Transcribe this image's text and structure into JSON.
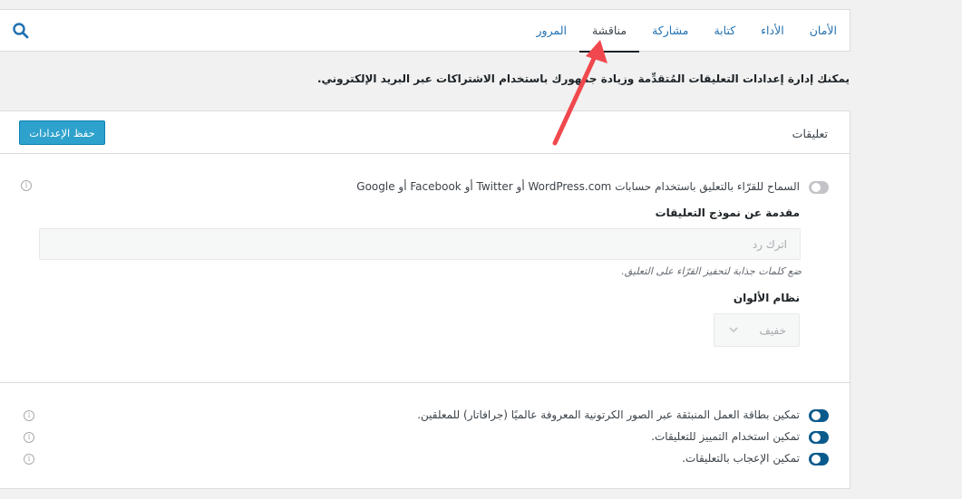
{
  "tabs": [
    {
      "label": "الأمان",
      "active": false
    },
    {
      "label": "الأداء",
      "active": false
    },
    {
      "label": "كتابة",
      "active": false
    },
    {
      "label": "مشاركة",
      "active": false
    },
    {
      "label": "مناقشة",
      "active": true
    },
    {
      "label": "المرور",
      "active": false
    }
  ],
  "intro": "يمكنك إدارة إعدادات التعليقات المُتقدِّمة وزيادة جمهورك باستخدام الاشتراكات عبر البريد الإلكتروني.",
  "card": {
    "title": "تعليقات",
    "save_label": "حفظ الإعدادات",
    "social_toggle": {
      "label": "السماح للقرّاء بالتعليق باستخدام حسابات WordPress.com أو Twitter أو Facebook أو Google",
      "enabled": false
    },
    "intro_field": {
      "title": "مقدمة عن نموذج التعليقات",
      "placeholder": "اترك رد",
      "hint": "ضع كلمات جذابة لتحفيز القرّاء على التعليق."
    },
    "color_scheme": {
      "title": "نظام الألوان",
      "value": "خفيف"
    },
    "toggles": [
      {
        "label": "تمكين بطاقة العمل المنبثقة عبر الصور الكرتونية المعروفة عالميًا (جرافاتار) للمعلقين.",
        "enabled": true
      },
      {
        "label": "تمكين استخدام التمييز للتعليقات.",
        "enabled": true
      },
      {
        "label": "تمكين الإعجاب بالتعليقات.",
        "enabled": true
      }
    ],
    "info_glyph": "i"
  },
  "colors": {
    "accent": "#2271b1",
    "button": "#2ea2cc",
    "toggle_on": "#0a5a8c",
    "arrow": "#f0484e"
  }
}
